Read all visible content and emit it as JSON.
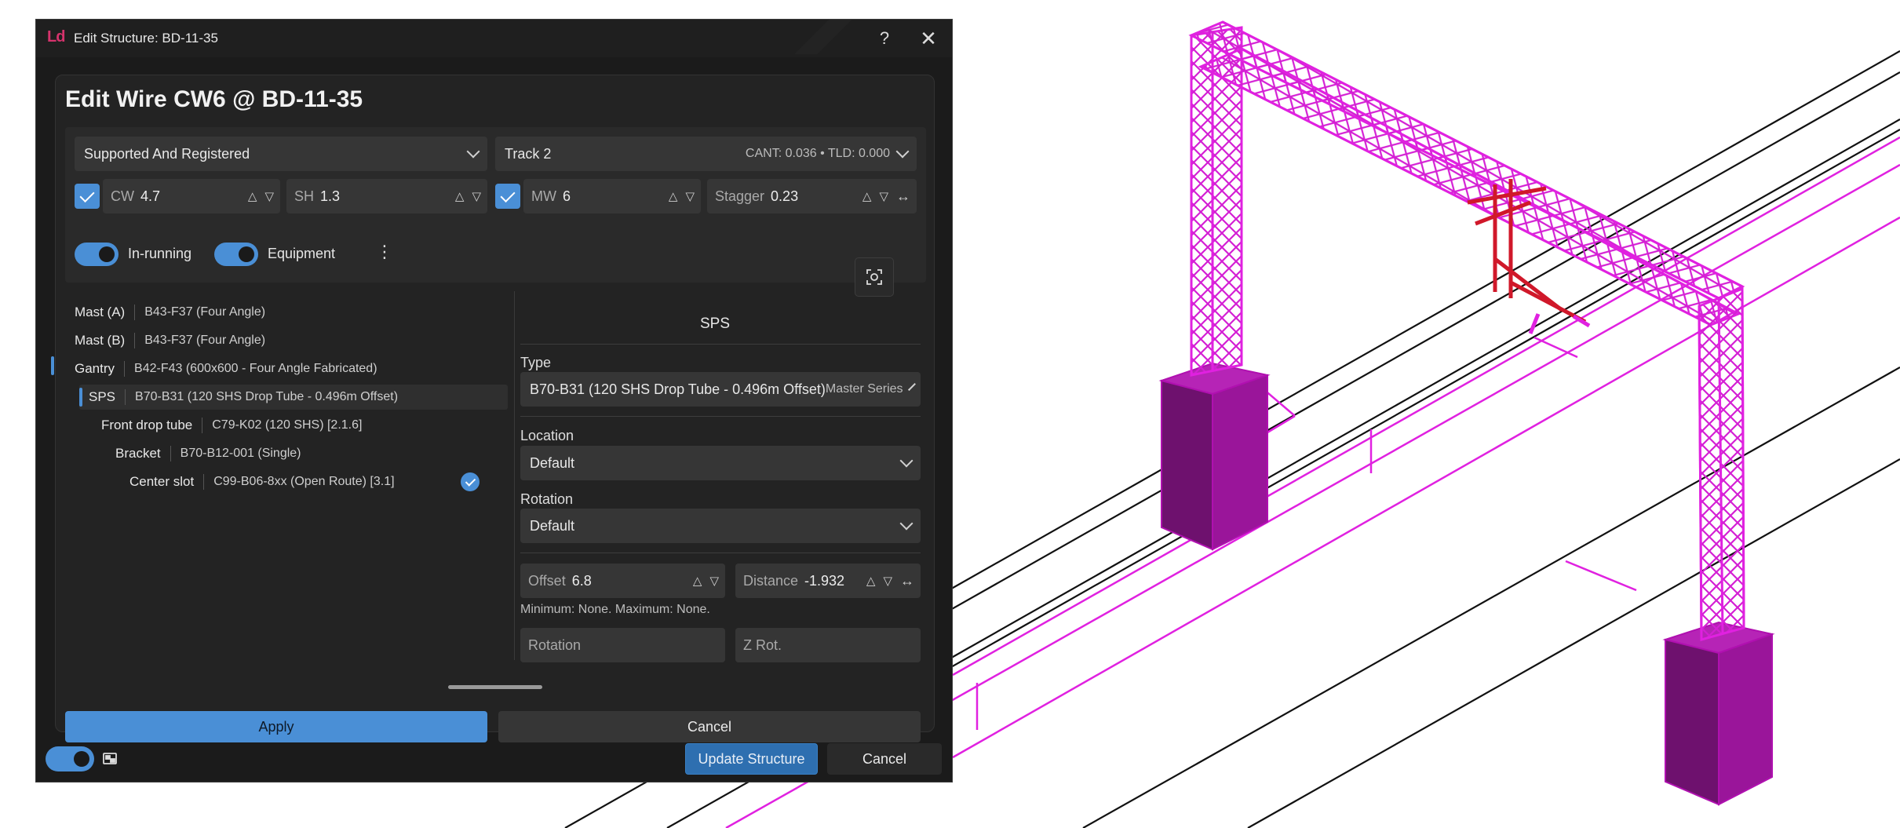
{
  "window": {
    "logo": "Ld",
    "title": "Edit Structure: BD-11-35"
  },
  "dialog": {
    "title": "Edit Wire CW6 @ BD-11-35",
    "registration": "Supported And Registered",
    "track": {
      "label": "Track 2",
      "detail": "CANT: 0.036 • TLD: 0.000"
    },
    "cw": {
      "label": "CW",
      "value": "4.7",
      "checked": true
    },
    "sh": {
      "label": "SH",
      "value": "1.3"
    },
    "mw": {
      "label": "MW",
      "value": "6",
      "checked": true
    },
    "stagger": {
      "label": "Stagger",
      "value": "0.23"
    },
    "toggles": [
      {
        "label": "In-running",
        "on": true
      },
      {
        "label": "Equipment",
        "on": true
      }
    ]
  },
  "tree": [
    {
      "key": "Mast (A)",
      "desc": "B43-F37 (Four Angle)"
    },
    {
      "key": "Mast (B)",
      "desc": "B43-F37 (Four Angle)"
    },
    {
      "key": "Gantry",
      "desc": "B42-F43 (600x600 - Four Angle Fabricated)"
    },
    {
      "key": "SPS",
      "desc": "B70-B31 (120 SHS Drop Tube - 0.496m Offset)",
      "selected": true
    },
    {
      "key": "Front drop tube",
      "desc": "C79-K02 (120 SHS) [2.1.6]"
    },
    {
      "key": "Bracket",
      "desc": "B70-B12-001 (Single)"
    },
    {
      "key": "Center slot",
      "desc": "C99-B06-8xx (Open Route) [3.1]",
      "checked": true
    }
  ],
  "sps_panel": {
    "title": "SPS",
    "type_label": "Type",
    "type_value": "B70-B31 (120 SHS Drop Tube - 0.496m Offset)",
    "type_series": "Master Series",
    "location_label": "Location",
    "location_value": "Default",
    "rotation_label": "Rotation",
    "rotation_value": "Default",
    "offset": {
      "label": "Offset",
      "value": "6.8"
    },
    "distance": {
      "label": "Distance",
      "value": "-1.932"
    },
    "hint": "Minimum: None. Maximum: None.",
    "rotation_field_placeholder": "Rotation",
    "zrot_field_placeholder": "Z Rot."
  },
  "buttons": {
    "apply": "Apply",
    "cancel": "Cancel",
    "update_structure": "Update Structure",
    "cancel_footer": "Cancel"
  },
  "colors": {
    "accent": "#4a8fd6",
    "structure": "#e021e0",
    "cantilever": "#d0182a"
  },
  "icons": [
    "checkbox-icon",
    "chevron-down-icon",
    "spinner-up-icon",
    "spinner-down-icon",
    "resize-arrows-icon",
    "kebab-menu-icon",
    "focus-target-icon",
    "check-circle-icon",
    "help-icon",
    "close-icon",
    "window-mode-icon"
  ]
}
